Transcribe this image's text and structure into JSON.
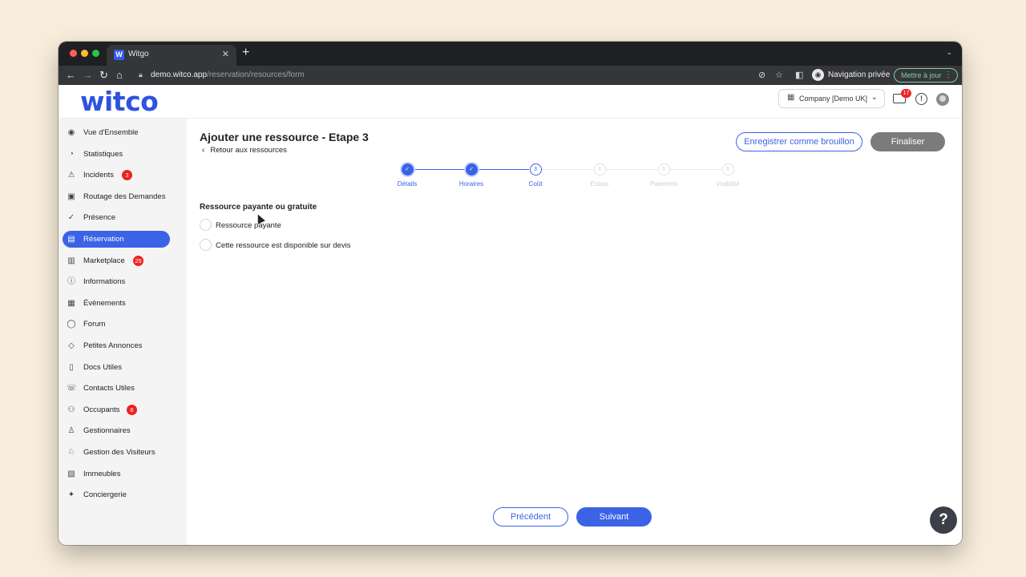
{
  "browser": {
    "tab_title": "Witgo",
    "tab_favicon": "W",
    "tab_close": "✕",
    "new_tab": "+",
    "tab_menu": "⌄",
    "url_domain": "demo.witco.app",
    "url_path": "/reservation/resources/form",
    "private_label": "Navigation privée",
    "update_label": "Mettre à jour"
  },
  "header": {
    "logo": "witco",
    "company": "Company [Demo UK]",
    "mail_badge": "17"
  },
  "sidebar": {
    "items": [
      {
        "label": "Vue d'Ensemble",
        "icon": "eye-icon"
      },
      {
        "label": "Statistiques",
        "icon": "pie-chart-icon"
      },
      {
        "label": "Incidents",
        "icon": "warning-icon",
        "badge": "3"
      },
      {
        "label": "Routage des Demandes",
        "icon": "routing-icon"
      },
      {
        "label": "Présence",
        "icon": "check-circle-icon"
      },
      {
        "label": "Réservation",
        "icon": "calendar-icon"
      },
      {
        "label": "Marketplace",
        "icon": "store-icon",
        "badge": "25"
      },
      {
        "label": "Informations",
        "icon": "info-icon"
      },
      {
        "label": "Évènements",
        "icon": "event-icon"
      },
      {
        "label": "Forum",
        "icon": "chat-icon"
      },
      {
        "label": "Petites Annonces",
        "icon": "tag-icon"
      },
      {
        "label": "Docs Utiles",
        "icon": "document-icon"
      },
      {
        "label": "Contacts Utiles",
        "icon": "phone-icon"
      },
      {
        "label": "Occupants",
        "icon": "users-icon",
        "badge": "6"
      },
      {
        "label": "Gestionnaires",
        "icon": "user-icon"
      },
      {
        "label": "Gestion des Visiteurs",
        "icon": "visitor-icon"
      },
      {
        "label": "Immeubles",
        "icon": "building-icon"
      },
      {
        "label": "Conciergerie",
        "icon": "concierge-icon"
      }
    ],
    "active_index": 5
  },
  "main": {
    "title": "Ajouter une ressource - Etape 3",
    "back_label": "Retour aux ressources",
    "draft_button": "Enregistrer comme brouillon",
    "finalize_button": "Finaliser",
    "steps": [
      {
        "number": "1",
        "label": "Détails",
        "state": "done"
      },
      {
        "number": "2",
        "label": "Horaires",
        "state": "done"
      },
      {
        "number": "3",
        "label": "Coût",
        "state": "current"
      },
      {
        "number": "4",
        "label": "Extras",
        "state": "todo"
      },
      {
        "number": "5",
        "label": "Paiement",
        "state": "todo"
      },
      {
        "number": "6",
        "label": "Visibilité",
        "state": "todo"
      }
    ],
    "section_title": "Ressource payante ou gratuite",
    "options": [
      {
        "label": "Ressource payante"
      },
      {
        "label": "Cette ressource est disponible sur devis"
      }
    ],
    "prev_button": "Précédent",
    "next_button": "Suivant"
  },
  "help_button": "?",
  "colors": {
    "accent": "#3a63e6",
    "badge": "#e22222",
    "finalize": "#7b7b7b"
  }
}
